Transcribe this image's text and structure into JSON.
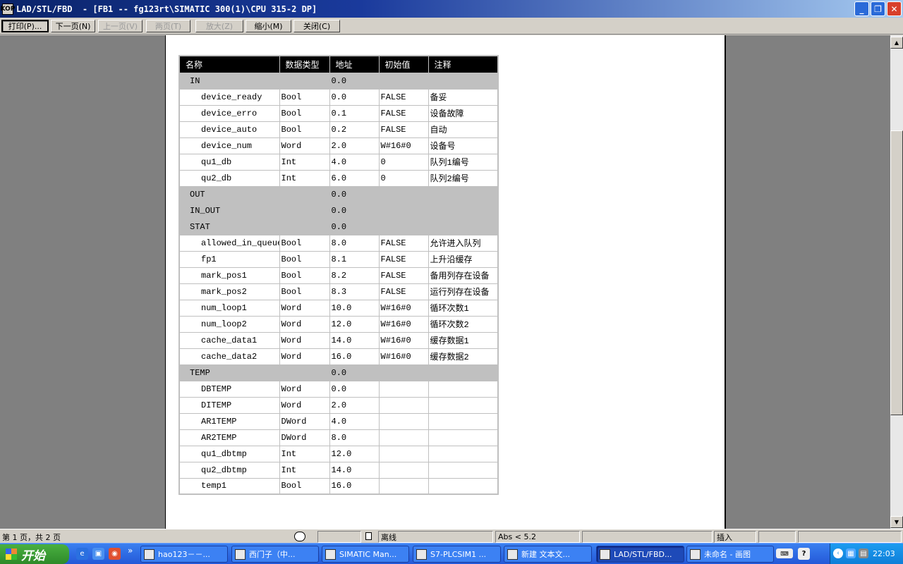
{
  "window": {
    "title": "LAD/STL/FBD  - [FB1 -- fg123rt\\SIMATIC 300(1)\\CPU 315-2 DP]",
    "icon": "KOP",
    "min_glyph": "_",
    "max_glyph": "❐",
    "close_glyph": "✕"
  },
  "toolbar": {
    "print": "打印(P)...",
    "next": "下一页(N)",
    "prev": "上一页(V)",
    "two_pages": "两页(T)",
    "zoom_in": "放大(Z)",
    "zoom_out": "缩小(M)",
    "close": "关闭(C)"
  },
  "table": {
    "headers": [
      "名称",
      "数据类型",
      "地址",
      "初始值",
      "注释"
    ],
    "rows": [
      {
        "section": true,
        "name": "IN",
        "type": "",
        "addr": "0.0",
        "init": "",
        "comment": ""
      },
      {
        "name": "device_ready",
        "type": "Bool",
        "addr": "0.0",
        "init": "FALSE",
        "comment": "备妥"
      },
      {
        "name": "device_erro",
        "type": "Bool",
        "addr": "0.1",
        "init": "FALSE",
        "comment": "设备故障"
      },
      {
        "name": "device_auto",
        "type": "Bool",
        "addr": "0.2",
        "init": "FALSE",
        "comment": "自动"
      },
      {
        "name": "device_num",
        "type": "Word",
        "addr": "2.0",
        "init": "W#16#0",
        "comment": "设备号"
      },
      {
        "name": "qu1_db",
        "type": "Int",
        "addr": "4.0",
        "init": "0",
        "comment": "队列1编号"
      },
      {
        "name": "qu2_db",
        "type": "Int",
        "addr": "6.0",
        "init": "0",
        "comment": "队列2编号"
      },
      {
        "section": true,
        "name": "OUT",
        "type": "",
        "addr": "0.0",
        "init": "",
        "comment": ""
      },
      {
        "section": true,
        "name": "IN_OUT",
        "type": "",
        "addr": "0.0",
        "init": "",
        "comment": ""
      },
      {
        "section": true,
        "name": "STAT",
        "type": "",
        "addr": "0.0",
        "init": "",
        "comment": ""
      },
      {
        "name": "allowed_in_queue",
        "type": "Bool",
        "addr": "8.0",
        "init": "FALSE",
        "comment": "允许进入队列"
      },
      {
        "name": "fp1",
        "type": "Bool",
        "addr": "8.1",
        "init": "FALSE",
        "comment": "上升沿缓存"
      },
      {
        "name": "mark_pos1",
        "type": "Bool",
        "addr": "8.2",
        "init": "FALSE",
        "comment": "备用列存在设备"
      },
      {
        "name": "mark_pos2",
        "type": "Bool",
        "addr": "8.3",
        "init": "FALSE",
        "comment": "运行列存在设备"
      },
      {
        "name": "num_loop1",
        "type": "Word",
        "addr": "10.0",
        "init": "W#16#0",
        "comment": "循环次数1"
      },
      {
        "name": "num_loop2",
        "type": "Word",
        "addr": "12.0",
        "init": "W#16#0",
        "comment": "循环次数2"
      },
      {
        "name": "cache_data1",
        "type": "Word",
        "addr": "14.0",
        "init": "W#16#0",
        "comment": "缓存数据1"
      },
      {
        "name": "cache_data2",
        "type": "Word",
        "addr": "16.0",
        "init": "W#16#0",
        "comment": "缓存数据2"
      },
      {
        "section": true,
        "name": "TEMP",
        "type": "",
        "addr": "0.0",
        "init": "",
        "comment": ""
      },
      {
        "name": "DBTEMP",
        "type": "Word",
        "addr": "0.0",
        "init": "",
        "comment": ""
      },
      {
        "name": "DITEMP",
        "type": "Word",
        "addr": "2.0",
        "init": "",
        "comment": ""
      },
      {
        "name": "AR1TEMP",
        "type": "DWord",
        "addr": "4.0",
        "init": "",
        "comment": ""
      },
      {
        "name": "AR2TEMP",
        "type": "DWord",
        "addr": "8.0",
        "init": "",
        "comment": ""
      },
      {
        "name": "qu1_dbtmp",
        "type": "Int",
        "addr": "12.0",
        "init": "",
        "comment": ""
      },
      {
        "name": "qu2_dbtmp",
        "type": "Int",
        "addr": "14.0",
        "init": "",
        "comment": ""
      },
      {
        "name": "temp1",
        "type": "Bool",
        "addr": "16.0",
        "init": "",
        "comment": ""
      }
    ]
  },
  "status": {
    "page": "第 1 页，共 2 页",
    "mode": "离线",
    "abs": "Abs < 5.2",
    "insert": "插入"
  },
  "taskbar": {
    "start": "开始",
    "chevron": "»",
    "tasks": [
      {
        "label": "hao123－－...",
        "active": false
      },
      {
        "label": "西门子（中...",
        "active": false
      },
      {
        "label": "SIMATIC Man...",
        "active": false
      },
      {
        "label": "S7-PLCSIM1 ...",
        "active": false
      },
      {
        "label": "新建 文本文...",
        "active": false
      },
      {
        "label": "LAD/STL/FBD...",
        "active": true
      },
      {
        "label": "未命名 - 画图",
        "active": false
      }
    ],
    "clock": "22:03"
  },
  "colors": {
    "title_start": "#0a246a",
    "section_row": "#c0c0c0",
    "header_row": "#000000",
    "taskbar": "#2458d8",
    "start_button": "#2e8a2a"
  }
}
